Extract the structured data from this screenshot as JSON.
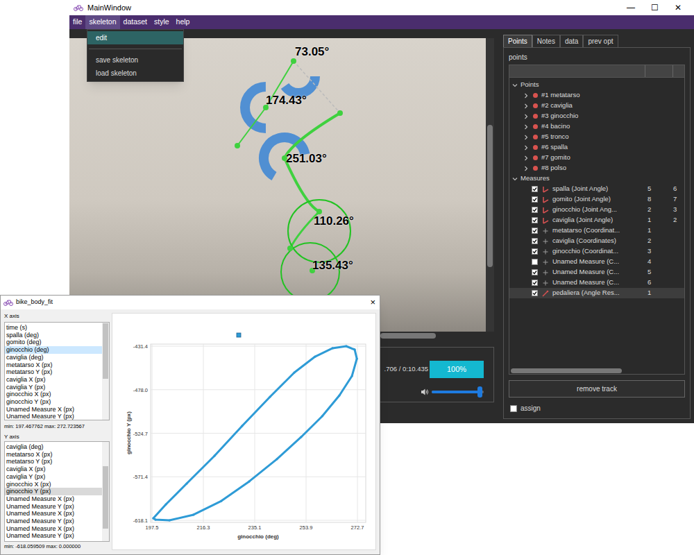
{
  "main_window": {
    "title": "MainWindow",
    "controls": [
      "—",
      "☐",
      "✕"
    ]
  },
  "menu": [
    {
      "label": "file",
      "selected": false
    },
    {
      "label": "skeleton",
      "selected": true
    },
    {
      "label": "dataset",
      "selected": false
    },
    {
      "label": "style",
      "selected": false
    },
    {
      "label": "help",
      "selected": false
    }
  ],
  "skeleton_menu": [
    {
      "label": "edit",
      "selected": true,
      "separator_after": true
    },
    {
      "label": "save skeleton",
      "selected": false,
      "separator_after": false
    },
    {
      "label": "load skeleton",
      "selected": false,
      "separator_after": false
    }
  ],
  "video": {
    "angle_labels": [
      "73.05°",
      "174.43°",
      "251.03°",
      "110.26°",
      "135.43°"
    ]
  },
  "player": {
    "time": ".706 / 0:10.435",
    "progress": {
      "label": "100%",
      "level": 1.0
    },
    "volume": {
      "level": 0.97
    }
  },
  "tabs": [
    {
      "label": "Points",
      "selected": true
    },
    {
      "label": "Notes",
      "selected": false
    },
    {
      "label": "data",
      "selected": false
    },
    {
      "label": "prev opt",
      "selected": false
    }
  ],
  "panel": {
    "title": "points",
    "points_group": {
      "label": "Points",
      "expanded": true,
      "items": [
        {
          "label": "#1 metatarso",
          "expanded": false
        },
        {
          "label": "#2 caviglia",
          "expanded": false
        },
        {
          "label": "#3 ginocchio",
          "expanded": false
        },
        {
          "label": "#4 bacino",
          "expanded": false
        },
        {
          "label": "#5 tronco",
          "expanded": false
        },
        {
          "label": "#6 spalla",
          "expanded": false
        },
        {
          "label": "#7 gomito",
          "expanded": false
        },
        {
          "label": "#8 polso",
          "expanded": false
        }
      ]
    },
    "measures_group": {
      "label": "Measures",
      "expanded": true,
      "items": [
        {
          "label": "spalla (Joint Angle)",
          "kind": "joint-angle",
          "checked": true,
          "col1": "5",
          "col2": "6",
          "selected": false
        },
        {
          "label": "gomito (Joint Angle)",
          "kind": "joint-angle",
          "checked": true,
          "col1": "8",
          "col2": "7",
          "selected": false
        },
        {
          "label": "ginocchio (Joint Ang...",
          "kind": "joint-angle",
          "checked": true,
          "col1": "2",
          "col2": "3",
          "selected": false
        },
        {
          "label": "caviglia (Joint Angle)",
          "kind": "joint-angle",
          "checked": true,
          "col1": "1",
          "col2": "2",
          "selected": false
        },
        {
          "label": "metatarso (Coordinat...",
          "kind": "coordinates",
          "checked": true,
          "col1": "1",
          "col2": "",
          "selected": false
        },
        {
          "label": "caviglia (Coordinates)",
          "kind": "coordinates",
          "checked": true,
          "col1": "2",
          "col2": "",
          "selected": false
        },
        {
          "label": "ginocchio (Coordinat...",
          "kind": "coordinates",
          "checked": true,
          "col1": "3",
          "col2": "",
          "selected": false
        },
        {
          "label": "Unamed Measure (C...",
          "kind": "coordinates",
          "checked": false,
          "col1": "4",
          "col2": "",
          "selected": false
        },
        {
          "label": "Unamed Measure (C...",
          "kind": "coordinates",
          "checked": true,
          "col1": "5",
          "col2": "",
          "selected": false
        },
        {
          "label": "Unamed Measure (C...",
          "kind": "coordinates",
          "checked": true,
          "col1": "6",
          "col2": "",
          "selected": false
        },
        {
          "label": "pedaliera (Angle Res...",
          "kind": "angle-res",
          "checked": true,
          "col1": "1",
          "col2": "",
          "selected": true
        }
      ]
    },
    "remove_button": "remove track",
    "assign": {
      "label": "assign",
      "checked": false
    }
  },
  "plot_window": {
    "title": "bike_body_fit",
    "close": "×",
    "x_axis": {
      "label": "X axis",
      "focused": true,
      "range_text": "min: 197.467762 max: 272.723567",
      "options": [
        {
          "label": "time (s)",
          "selected": false
        },
        {
          "label": "spalla (deg)",
          "selected": false
        },
        {
          "label": "gomito (deg)",
          "selected": false
        },
        {
          "label": "ginocchio (deg)",
          "selected": true
        },
        {
          "label": "caviglia (deg)",
          "selected": false
        },
        {
          "label": "metatarso X (px)",
          "selected": false
        },
        {
          "label": "metatarso Y (px)",
          "selected": false
        },
        {
          "label": "caviglia X (px)",
          "selected": false
        },
        {
          "label": "caviglia Y (px)",
          "selected": false
        },
        {
          "label": "ginocchio X (px)",
          "selected": false
        },
        {
          "label": "ginocchio Y (px)",
          "selected": false
        },
        {
          "label": "Unamed Measure X (px)",
          "selected": false
        },
        {
          "label": "Unamed Measure Y (px)",
          "selected": false
        }
      ]
    },
    "y_axis": {
      "label": "Y axis",
      "focused": false,
      "range_text": "min: -618.059509 max: 0.000000",
      "options": [
        {
          "label": "caviglia (deg)",
          "selected": false
        },
        {
          "label": "metatarso X (px)",
          "selected": false
        },
        {
          "label": "metatarso Y (px)",
          "selected": false
        },
        {
          "label": "caviglia X (px)",
          "selected": false
        },
        {
          "label": "caviglia Y (px)",
          "selected": false
        },
        {
          "label": "ginocchio X (px)",
          "selected": false
        },
        {
          "label": "ginocchio Y (px)",
          "selected": true
        },
        {
          "label": "Unamed Measure X (px)",
          "selected": false
        },
        {
          "label": "Unamed Measure Y (px)",
          "selected": false
        },
        {
          "label": "Unamed Measure X (px)",
          "selected": false
        },
        {
          "label": "Unamed Measure Y (px)",
          "selected": false
        },
        {
          "label": "Unamed Measure X (px)",
          "selected": false
        },
        {
          "label": "Unamed Measure Y (px)",
          "selected": false
        }
      ]
    },
    "chart": {
      "x_title": "ginocchio (deg)",
      "y_title": "ginocchio Y (px)",
      "x_ticks": [
        "197.5",
        "216.3",
        "235.1",
        "253.9",
        "272.7"
      ],
      "y_ticks": [
        "-431.4",
        "-478.0",
        "-524.7",
        "-571.4",
        "-618.1"
      ],
      "series": [
        {
          "x": [
            198.0,
            202.6,
            210.2,
            220.4,
            230.5,
            240.7,
            249.6,
            257.2,
            263.6,
            268.6,
            271.7,
            272.5,
            270.7,
            266.1,
            259.8,
            252.1,
            243.2,
            233.1,
            222.9,
            212.7,
            203.9,
            198.8
          ],
          "y": [
            -615.9,
            -601.0,
            -578.7,
            -548.9,
            -516.9,
            -485.7,
            -459.7,
            -442.6,
            -433.6,
            -431.4,
            -435.1,
            -444.8,
            -463.4,
            -484.2,
            -506.5,
            -528.8,
            -552.6,
            -576.4,
            -597.3,
            -612.1,
            -618.1,
            -617.4
          ]
        }
      ]
    }
  }
}
